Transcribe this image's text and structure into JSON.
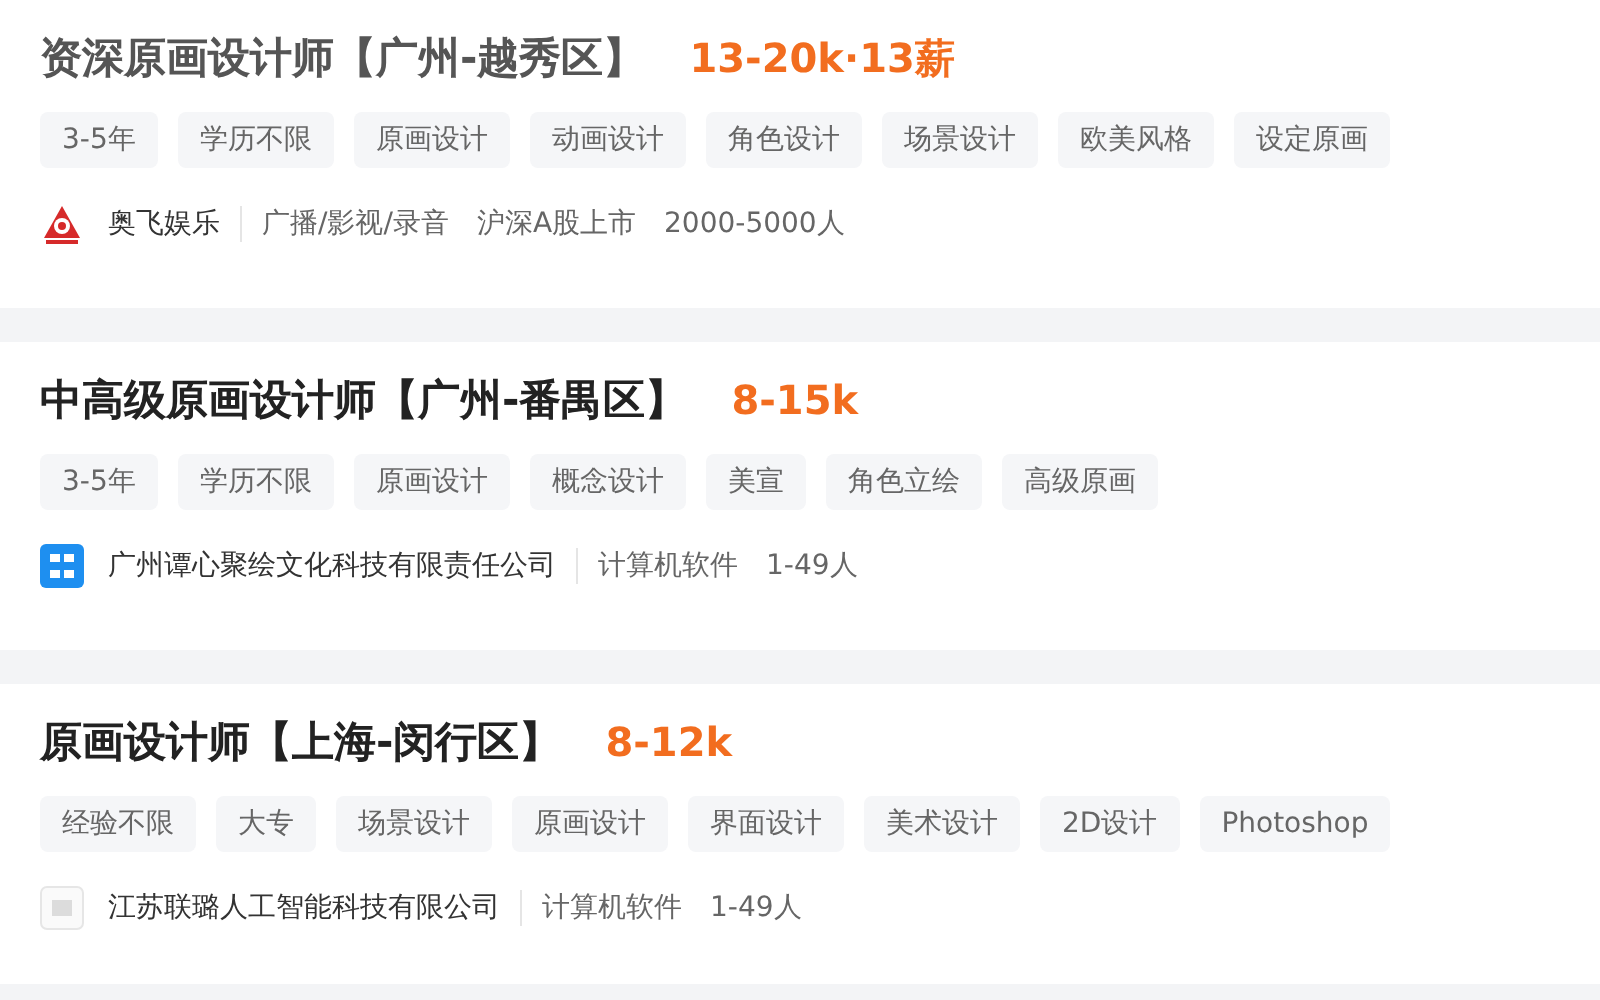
{
  "jobs": [
    {
      "title": "资深原画设计师【广州-越秀区】",
      "visited": true,
      "salary": "13-20k·13薪",
      "tags": [
        "3-5年",
        "学历不限",
        "原画设计",
        "动画设计",
        "角色设计",
        "场景设计",
        "欧美风格",
        "设定原画"
      ],
      "company": {
        "kind": "red-emblem",
        "name": "奥飞娱乐",
        "details": [
          "广播/影视/录音",
          "沪深A股上市",
          "2000-5000人"
        ]
      }
    },
    {
      "title": "中高级原画设计师【广州-番禺区】",
      "visited": false,
      "salary": "8-15k",
      "tags": [
        "3-5年",
        "学历不限",
        "原画设计",
        "概念设计",
        "美宣",
        "角色立绘",
        "高级原画"
      ],
      "company": {
        "kind": "blue-square",
        "name": "广州谭心聚绘文化科技有限责任公司",
        "details": [
          "计算机软件",
          "1-49人"
        ]
      }
    },
    {
      "title": "原画设计师【上海-闵行区】",
      "visited": false,
      "salary": "8-12k",
      "tags": [
        "经验不限",
        "大专",
        "场景设计",
        "原画设计",
        "界面设计",
        "美术设计",
        "2D设计",
        "Photoshop"
      ],
      "company": {
        "kind": "plain",
        "name": "江苏联璐人工智能科技有限公司",
        "details": [
          "计算机软件",
          "1-49人"
        ]
      }
    }
  ]
}
